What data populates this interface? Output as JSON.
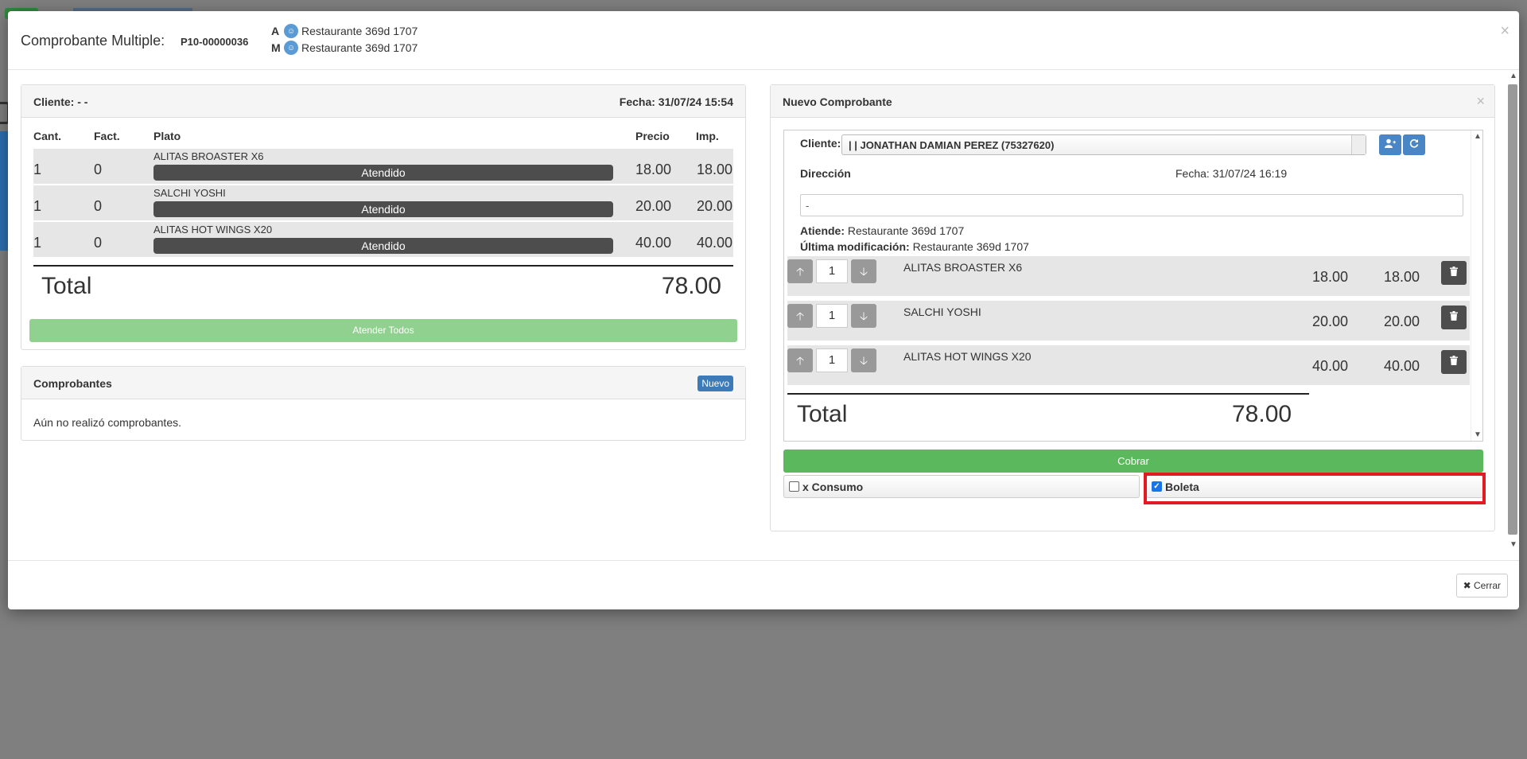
{
  "modal": {
    "title": "Comprobante Multiple:",
    "code": "P10-00000036",
    "attended_by": [
      {
        "letter": "A",
        "name": "Restaurante 369d 1707"
      },
      {
        "letter": "M",
        "name": "Restaurante 369d 1707"
      }
    ],
    "close_glyph": "×"
  },
  "order_panel": {
    "client_label": "Cliente: - -",
    "date_label": "Fecha: 31/07/24 15:54",
    "headers": {
      "cant": "Cant.",
      "fact": "Fact.",
      "plato": "Plato",
      "precio": "Precio",
      "imp": "Imp."
    },
    "rows": [
      {
        "cant": "1",
        "fact": "0",
        "plato": "ALITAS BROASTER X6",
        "status": "Atendido",
        "precio": "18.00",
        "imp": "18.00"
      },
      {
        "cant": "1",
        "fact": "0",
        "plato": "SALCHI YOSHI",
        "status": "Atendido",
        "precio": "20.00",
        "imp": "20.00"
      },
      {
        "cant": "1",
        "fact": "0",
        "plato": "ALITAS HOT WINGS X20",
        "status": "Atendido",
        "precio": "40.00",
        "imp": "40.00"
      }
    ],
    "total_label": "Total",
    "total_value": "78.00",
    "attend_all_label": "Atender Todos"
  },
  "comprobantes_panel": {
    "title": "Comprobantes",
    "new_label": "Nuevo",
    "empty_text": "Aún no realizó comprobantes."
  },
  "new_voucher": {
    "title": "Nuevo Comprobante",
    "close_glyph": "×",
    "client_label": "Cliente:",
    "client_value": "| | JONATHAN DAMIAN PEREZ (75327620)",
    "address_label": "Dirección",
    "date_label": "Fecha: 31/07/24 16:19",
    "address_value": "-",
    "attends_label": "Atiende:",
    "attends_value": "Restaurante 369d 1707",
    "modified_label": "Última modificación:",
    "modified_value": "Restaurante 369d 1707",
    "items": [
      {
        "qty": "1",
        "name": "ALITAS BROASTER X6",
        "price": "18.00",
        "imp": "18.00"
      },
      {
        "qty": "1",
        "name": "SALCHI YOSHI",
        "price": "20.00",
        "imp": "20.00"
      },
      {
        "qty": "1",
        "name": "ALITAS HOT WINGS X20",
        "price": "40.00",
        "imp": "40.00"
      }
    ],
    "total_label": "Total",
    "total_value": "78.00",
    "pay_label": "Cobrar",
    "consumo_label": "x Consumo",
    "consumo_checked": false,
    "boleta_label": "Boleta",
    "boleta_checked": true
  },
  "footer": {
    "close_label": "Cerrar",
    "close_icon": "x-icon"
  },
  "colors": {
    "highlight": "#e01b24",
    "success": "#5cb85c",
    "primary": "#3d7ab8"
  }
}
